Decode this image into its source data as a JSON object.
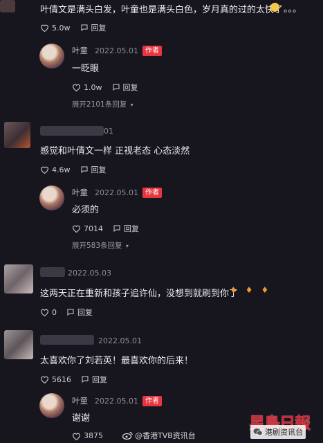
{
  "c1": {
    "text": "叶倩文是满头白发，叶童也是满头白色，岁月真的过的太快了",
    "likes": "5.0w",
    "reply": "回复",
    "r1": {
      "name": "叶童",
      "date": "2022.05.01",
      "badge": "作者",
      "text": "一眨眼",
      "likes": "1.0w",
      "reply": "回复",
      "expand": "展开2101条回复"
    }
  },
  "c2": {
    "user_suffix": "01",
    "text": "感觉和叶倩文一样 正视老态 心态淡然",
    "likes": "4.6w",
    "reply": "回复",
    "r1": {
      "name": "叶童",
      "date": "2022.05.01",
      "badge": "作者",
      "text": "必须的",
      "likes": "7014",
      "reply": "回复",
      "expand": "展开583条回复"
    }
  },
  "c3": {
    "date": "2022.05.03",
    "text": "这两天正在重新和孩子追许仙，没想到就刷到你了",
    "likes": "0",
    "reply": "回复"
  },
  "c4": {
    "date": "2022.05.01",
    "text": "太喜欢你了刘若英！最喜欢你的后来！",
    "likes": "5616",
    "reply": "回复",
    "r1": {
      "name": "叶童",
      "date": "2022.05.01",
      "badge": "作者",
      "text": "谢谢",
      "likes": "3875",
      "reply": "回复"
    }
  },
  "watermark": {
    "weibo": "@香港TVB资讯台",
    "logo": "星島日報",
    "wechat": "港剧资讯台"
  },
  "colors": {
    "bg": "#17161f",
    "badge": "#e8353f",
    "logo_red": "#d9232e"
  }
}
